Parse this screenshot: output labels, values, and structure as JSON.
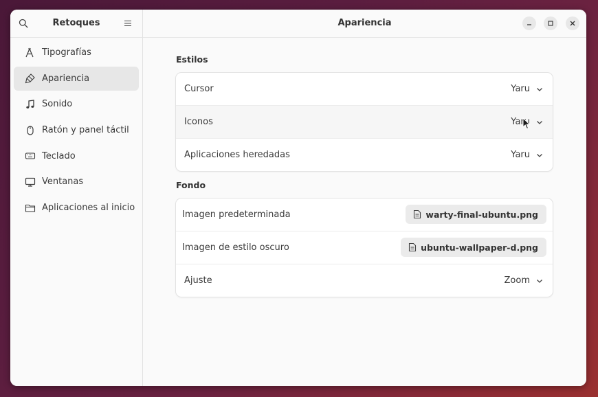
{
  "sidebar": {
    "title": "Retoques",
    "items": [
      {
        "label": "Tipografías",
        "icon": "typography-icon",
        "active": false
      },
      {
        "label": "Apariencia",
        "icon": "brush-icon",
        "active": true
      },
      {
        "label": "Sonido",
        "icon": "music-note-icon",
        "active": false
      },
      {
        "label": "Ratón y panel táctil",
        "icon": "mouse-icon",
        "active": false
      },
      {
        "label": "Teclado",
        "icon": "keyboard-icon",
        "active": false
      },
      {
        "label": "Ventanas",
        "icon": "monitor-icon",
        "active": false
      },
      {
        "label": "Aplicaciones al inicio",
        "icon": "folder-icon",
        "active": false
      }
    ]
  },
  "main": {
    "title": "Apariencia",
    "styles": {
      "title": "Estilos",
      "rows": [
        {
          "label": "Cursor",
          "value": "Yaru"
        },
        {
          "label": "Iconos",
          "value": "Yaru"
        },
        {
          "label": "Aplicaciones heredadas",
          "value": "Yaru"
        }
      ]
    },
    "background": {
      "title": "Fondo",
      "rows": [
        {
          "label": "Imagen predeterminada",
          "file": "warty-final-ubuntu.png"
        },
        {
          "label": "Imagen de estilo oscuro",
          "file": "ubuntu-wallpaper-d.png"
        },
        {
          "label": "Ajuste",
          "value": "Zoom"
        }
      ]
    }
  }
}
